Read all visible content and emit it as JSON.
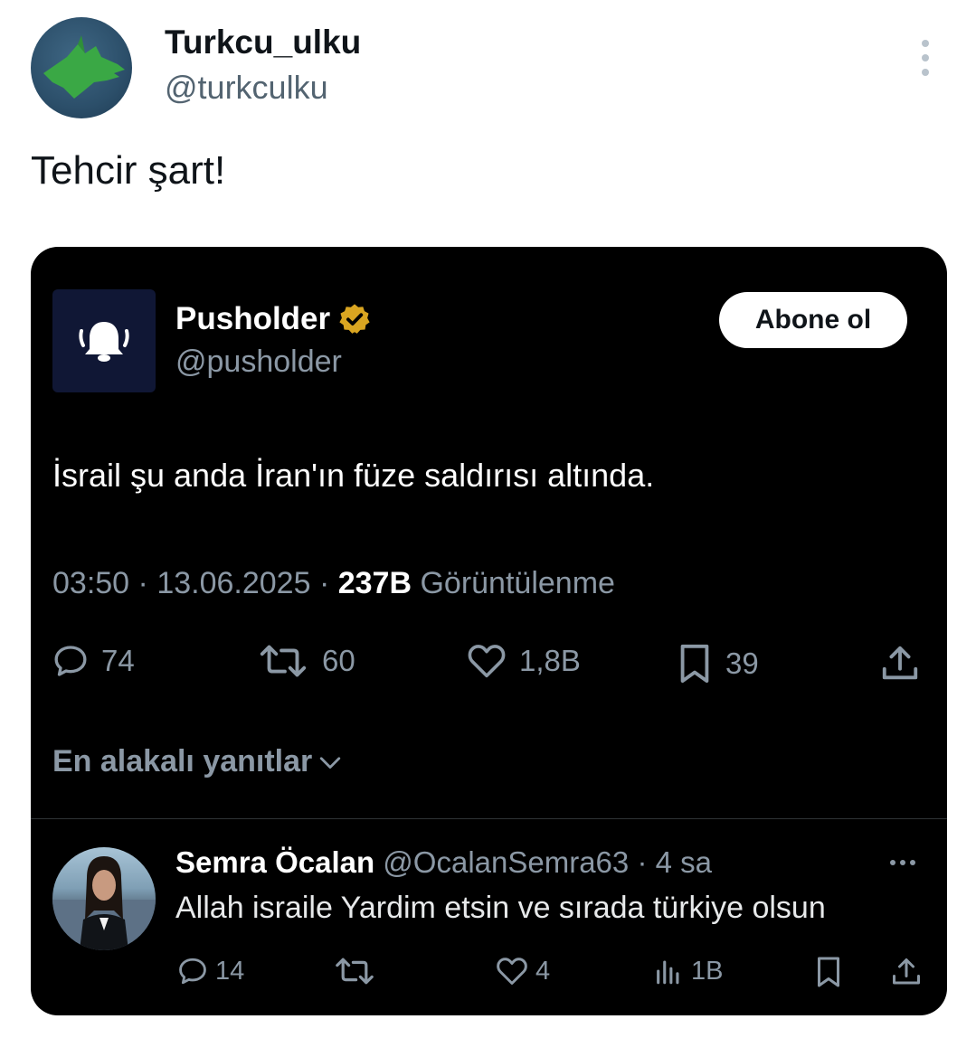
{
  "outer_tweet": {
    "display_name": "Turkcu_ulku",
    "handle": "@turkculku",
    "text": "Tehcir şart!",
    "avatar_icon": "wolf-head-icon",
    "more_icon": "vertical-ellipsis-icon"
  },
  "embedded_tweet": {
    "display_name": "Pusholder",
    "handle": "@pusholder",
    "verified_color": "#d9a521",
    "follow_label": "Abone ol",
    "text": "İsrail şu anda İran'ın füze saldırısı altında.",
    "time": "03:50",
    "date": "13.06.2025",
    "views": "237B",
    "views_label": "Görüntülenme",
    "separator": "·",
    "actions": {
      "replies": "74",
      "reposts": "60",
      "likes": "1,8B",
      "bookmarks": "39"
    },
    "replies_sort_label": "En alakalı yanıtlar"
  },
  "reply": {
    "display_name": "Semra Öcalan",
    "handle": "@OcalanSemra63",
    "time": "4 sa",
    "text": "Allah israile Yardim etsin ve sırada türkiye olsun",
    "actions": {
      "replies": "14",
      "likes": "4",
      "views": "1B"
    }
  },
  "colors": {
    "embed_background": "#000000",
    "secondary_text": "#8b98a5",
    "outer_handle": "#536471"
  }
}
